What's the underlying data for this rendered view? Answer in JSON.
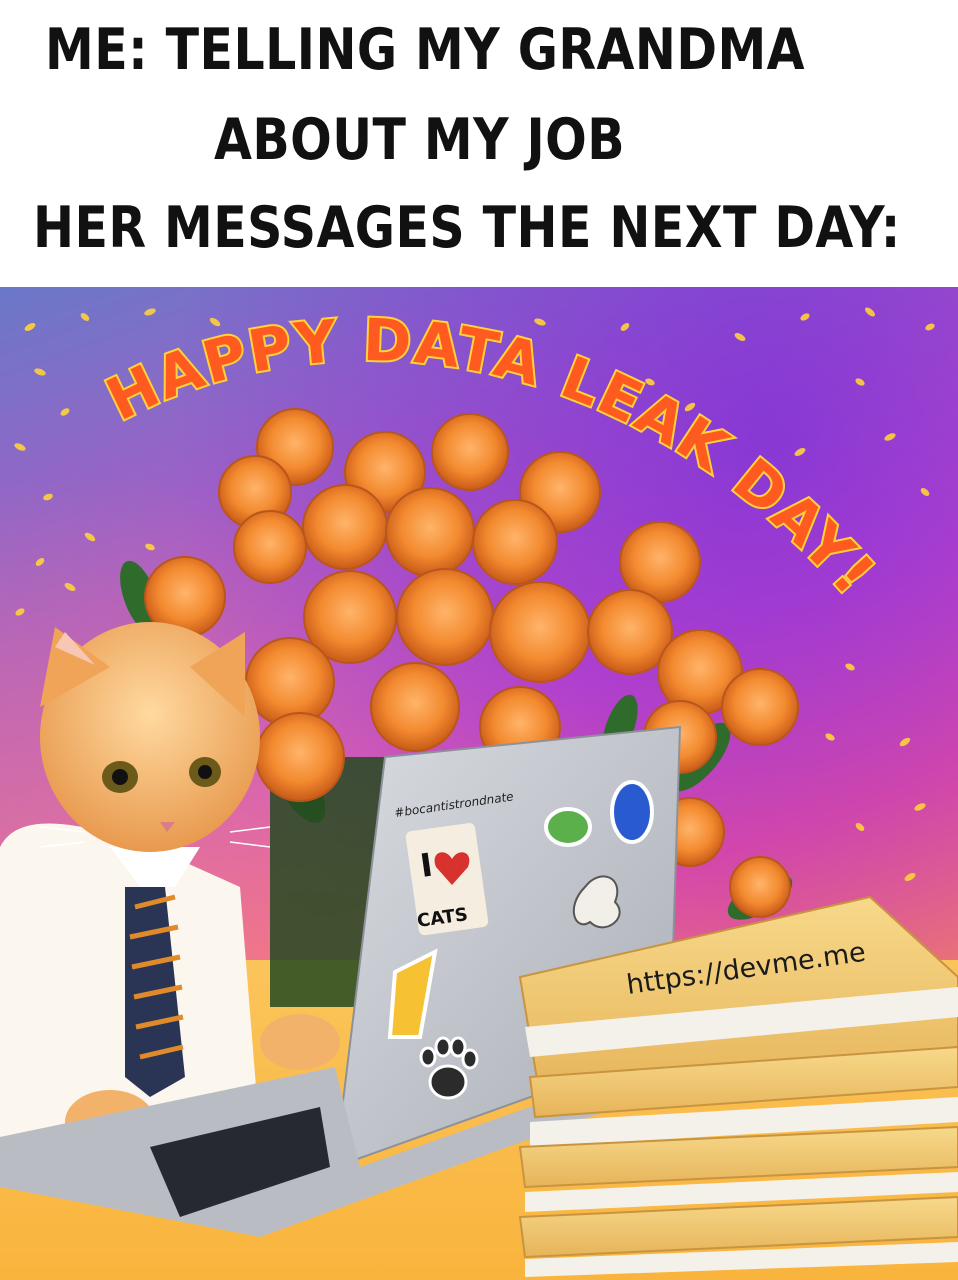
{
  "caption": {
    "line1": "ME: TELLING MY GRANDMA",
    "line2": "ABOUT MY JOB",
    "line3": "HER MESSAGES THE NEXT DAY:"
  },
  "image": {
    "banner": "HAPPY DATA LEAK DAY!",
    "laptop_sticker_top": "#bocantistrondnate",
    "sticker_love_i": "I",
    "sticker_love_cats": "CATS",
    "watermark": "https://devme.me"
  },
  "colors": {
    "banner_fill": "#ff5a1f",
    "banner_outline": "#ffd23a",
    "rose": "#f0872e",
    "background_top": "#7a3fe0",
    "background_bottom": "#f8b14b"
  },
  "icons": [
    "heart-icon",
    "paw-icon",
    "rose-icon",
    "cat-icon"
  ]
}
